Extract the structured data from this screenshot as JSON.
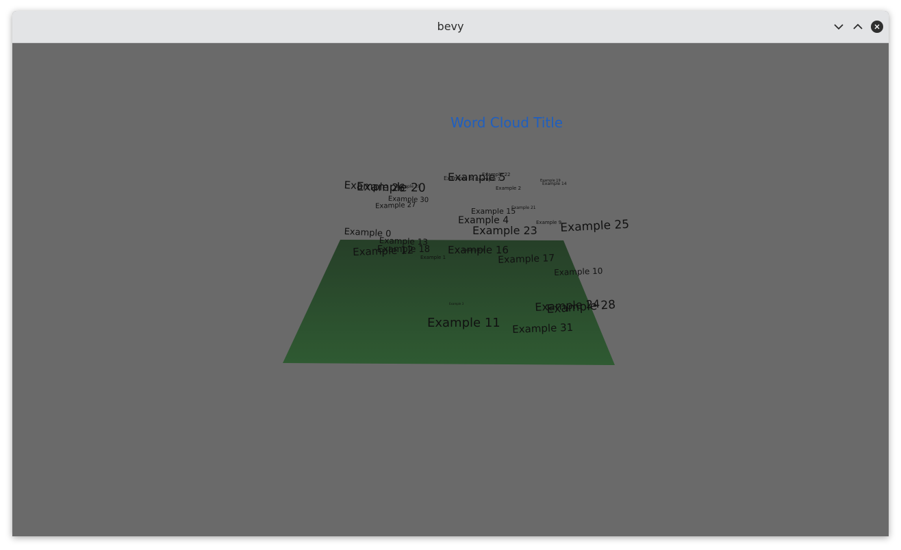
{
  "window": {
    "title": "bevy",
    "minimize_icon": "chevron-down-icon",
    "maximize_icon": "chevron-up-icon",
    "close_icon": "close-icon"
  },
  "scene": {
    "background_color": "#6a6a6a",
    "ground_color": "#2f5a32",
    "title": "Word Cloud Title",
    "title_color": "#1f5fbf",
    "words": [
      "Example 26",
      "Example 20",
      "Example 30",
      "Example 27",
      "Example 0",
      "Example 13",
      "Example 18",
      "Example 12",
      "Example 1",
      "Example 5",
      "Example 22",
      "Example 2",
      "Example 15",
      "Example 21",
      "Example 4",
      "Example 23",
      "Example 9",
      "Example 25",
      "Example 16",
      "Example 17",
      "Example 10",
      "Example 24",
      "Example 28",
      "Example 11",
      "Example 31",
      "Example 3",
      "Example 14",
      "Example 19",
      "Example 6",
      "Example 7",
      "Example 8",
      "Example 29"
    ]
  }
}
